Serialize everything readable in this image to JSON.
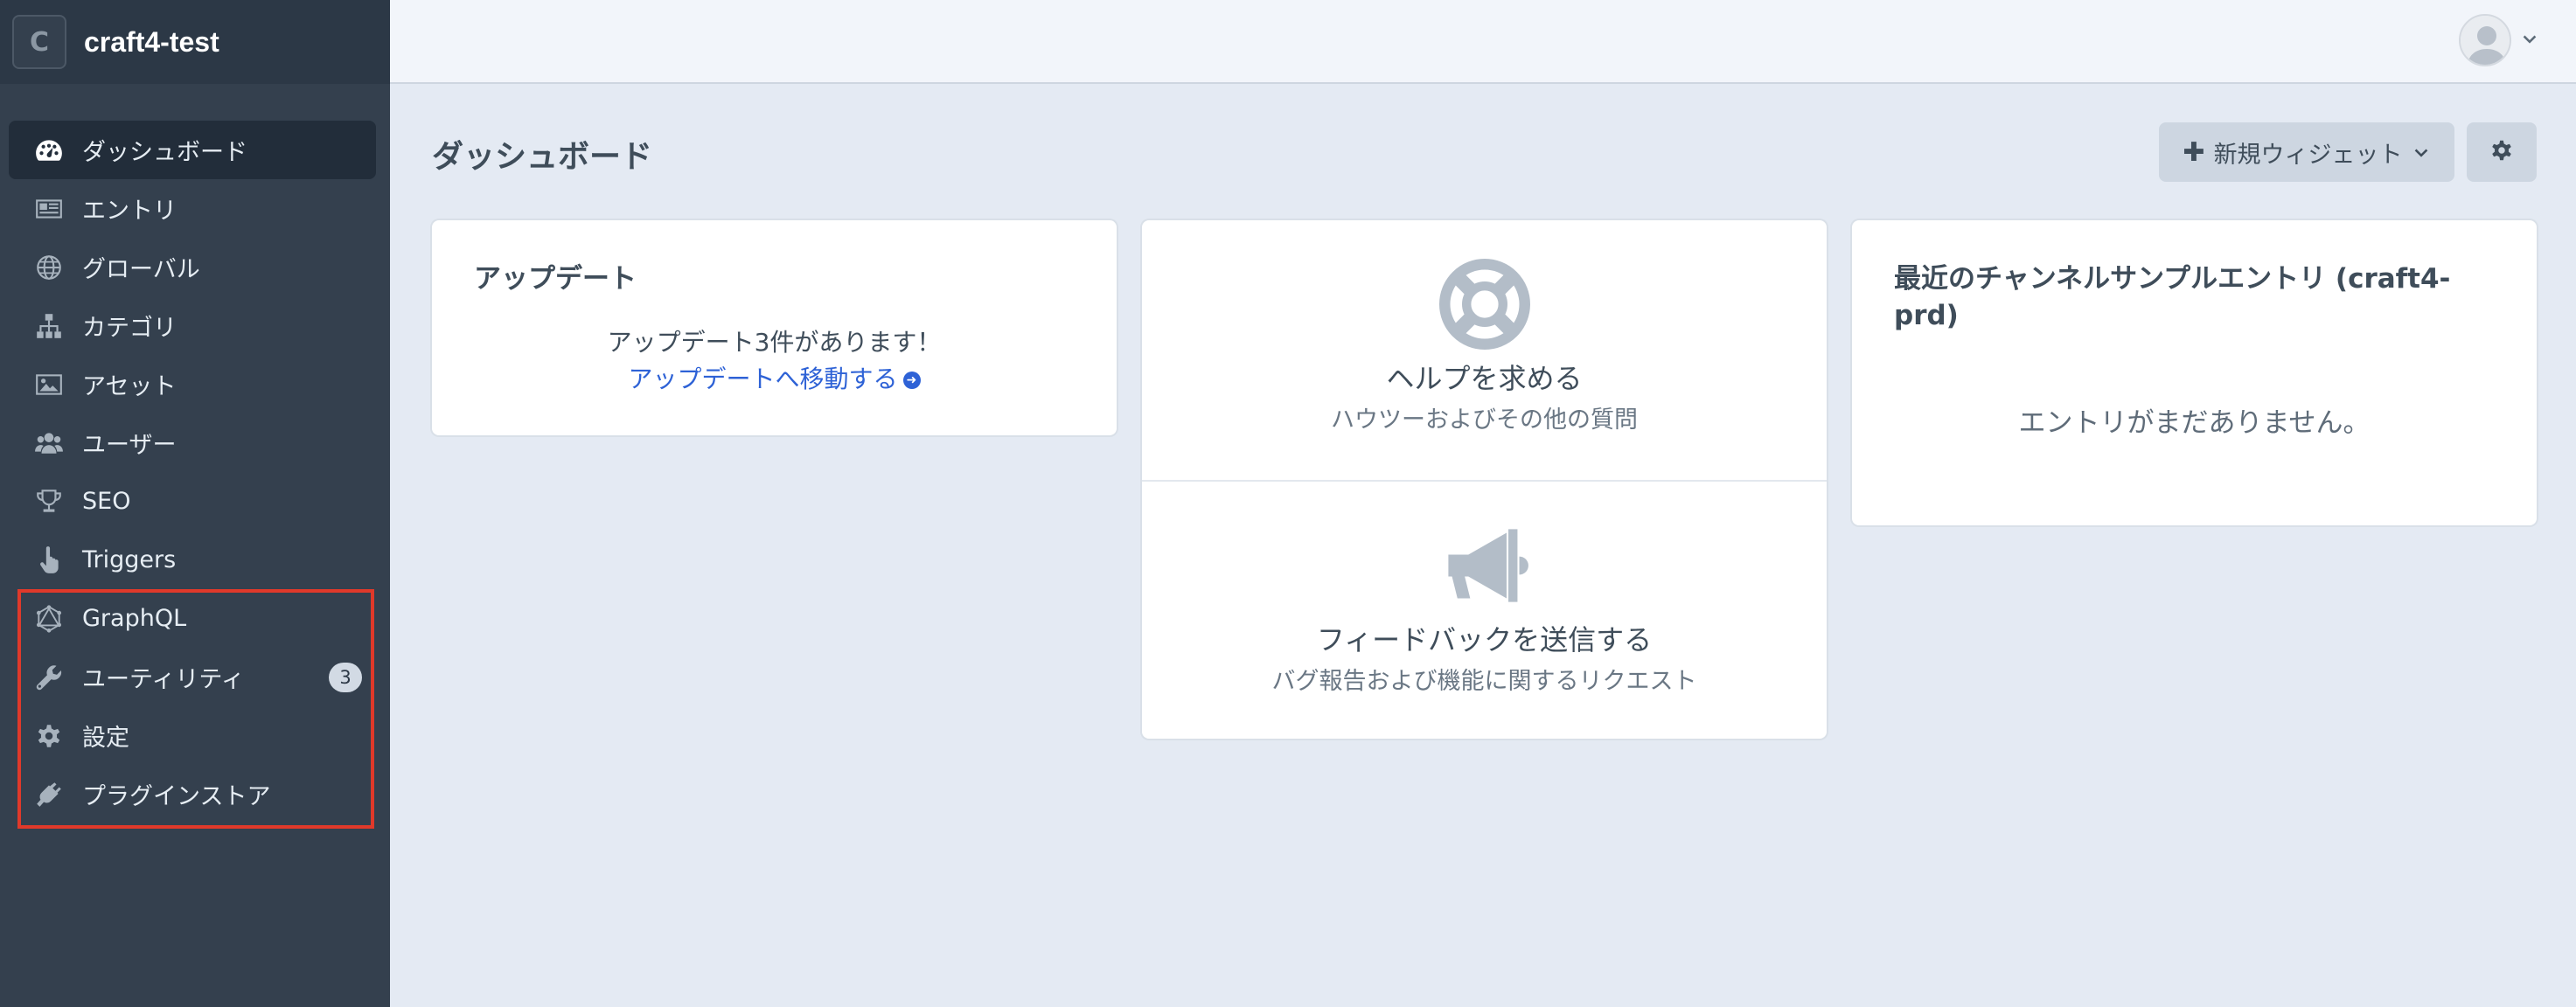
{
  "site": {
    "logo_letter": "C",
    "name": "craft4-test"
  },
  "sidebar": {
    "items": [
      {
        "label": "ダッシュボード",
        "icon": "dashboard-gauge-icon",
        "active": true
      },
      {
        "label": "エントリ",
        "icon": "newspaper-icon"
      },
      {
        "label": "グローバル",
        "icon": "globe-icon"
      },
      {
        "label": "カテゴリ",
        "icon": "sitemap-icon"
      },
      {
        "label": "アセット",
        "icon": "image-icon"
      },
      {
        "label": "ユーザー",
        "icon": "users-icon"
      },
      {
        "label": "SEO",
        "icon": "trophy-icon"
      },
      {
        "label": "Triggers",
        "icon": "pointer-hand-icon"
      },
      {
        "label": "GraphQL",
        "icon": "graphql-icon"
      },
      {
        "label": "ユーティリティ",
        "icon": "wrench-icon",
        "badge": "3"
      },
      {
        "label": "設定",
        "icon": "gear-icon"
      },
      {
        "label": "プラグインストア",
        "icon": "plug-icon"
      }
    ]
  },
  "header": {
    "user_avatar": "avatar-icon"
  },
  "main": {
    "title": "ダッシュボード",
    "new_widget_label": "新規ウィジェット",
    "widgets": {
      "updates": {
        "title": "アップデート",
        "message": "アップデート3件があります！",
        "link": "アップデートへ移動する"
      },
      "help": {
        "get_help_title": "ヘルプを求める",
        "get_help_desc": "ハウツーおよびその他の質問",
        "feedback_title": "フィードバックを送信する",
        "feedback_desc": "バグ報告および機能に関するリクエスト"
      },
      "recent": {
        "title": "最近のチャンネルサンプルエントリ (craft4-prd)",
        "empty": "エントリがまだありません。"
      }
    }
  },
  "colors": {
    "sidebar_bg": "#34404e",
    "sidebar_active": "#222d3a",
    "link": "#2e62d6",
    "highlight": "#e0392a",
    "main_bg": "#e4eaf3"
  }
}
